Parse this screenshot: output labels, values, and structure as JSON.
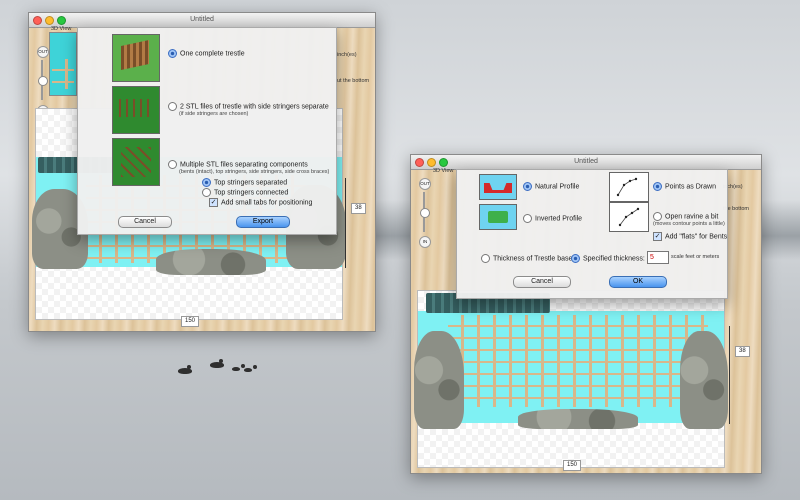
{
  "left_window": {
    "title": "Untitled",
    "view_tab": "3D View",
    "units": "inch(es)",
    "side_note": "ut the bottom",
    "zoom_out": "OUT",
    "zoom_in": "IN",
    "height_value": "38",
    "width_value": "150",
    "sheet": {
      "option1": "One complete trestle",
      "option2": "2 STL files of trestle with side stringers separate",
      "option2_sub": "(if side stringers are chosen)",
      "option3": "Multiple STL files separating components",
      "option3_sub": "(bents (intact), top stringers, side stringers, side cross braces)",
      "sub_option1": "Top stringers separated",
      "sub_option2": "Top stringers connected",
      "check_tabs": "Add small tabs for positioning",
      "cancel": "Cancel",
      "export": "Export"
    }
  },
  "right_window": {
    "title": "Untitled",
    "view_tab": "3D View",
    "units": "inch(es)",
    "side_note": "the bottom",
    "zoom_out": "OUT",
    "zoom_in": "IN",
    "height_value": "38",
    "width_value": "150",
    "sheet": {
      "natural_profile": "Natural Profile",
      "inverted_profile": "Inverted Profile",
      "points_as_drawn": "Points as Drawn",
      "open_ravine": "Open ravine a bit",
      "open_ravine_sub": "(moves contour points a little)",
      "add_flats": "Add \"flats\" for Bents",
      "thickness_base": "Thickness of Trestle base",
      "specified_thickness": "Specified thickness:",
      "thickness_value": "5",
      "thickness_unit": "scale feet or meters",
      "cancel": "Cancel",
      "ok": "OK"
    }
  },
  "colors": {
    "sky": "#7ff1f3",
    "accent_button": "#4a94ee",
    "wood": "#e9d5b2"
  }
}
